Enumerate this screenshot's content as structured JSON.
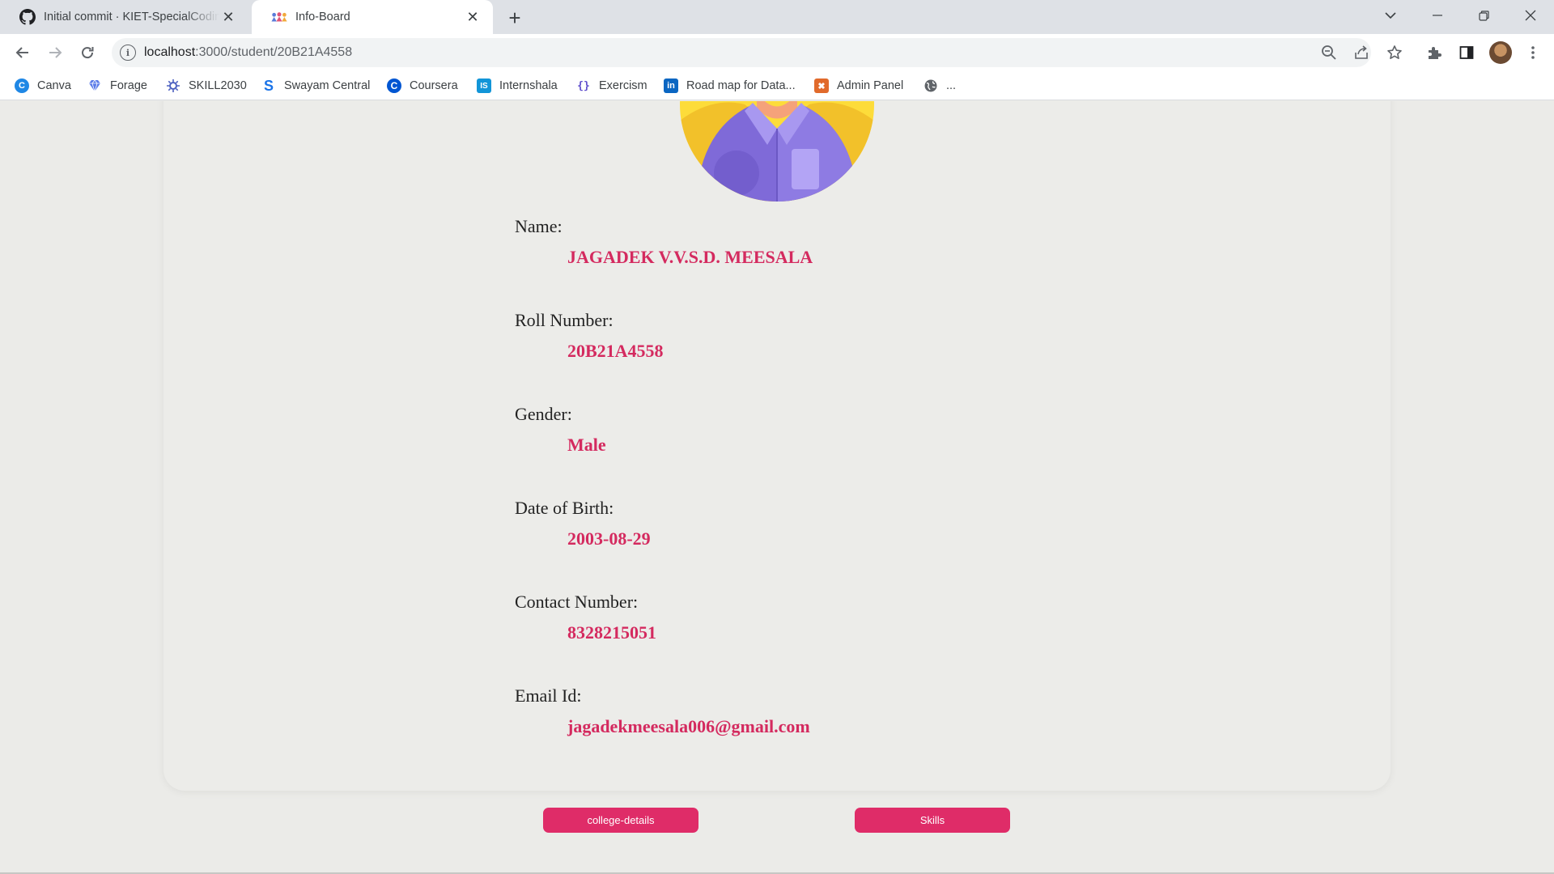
{
  "browser": {
    "tabs": [
      {
        "title": "Initial commit · KIET-SpecialCoding",
        "close": "✕"
      },
      {
        "title": "Info-Board",
        "close": "✕"
      }
    ],
    "new_tab": "+",
    "url": {
      "host": "localhost",
      "path": ":3000/student/20B21A4558"
    },
    "bookmarks": [
      {
        "label": "Canva",
        "icon": "canva-icon",
        "color": "#1f87e5"
      },
      {
        "label": "Forage",
        "icon": "forage-icon",
        "color": "#5b7be8"
      },
      {
        "label": "SKILL2030",
        "icon": "skill2030-icon",
        "color": "#4b5fc0"
      },
      {
        "label": "Swayam Central",
        "icon": "swayam-icon",
        "color": "#1a73e8"
      },
      {
        "label": "Coursera",
        "icon": "coursera-icon",
        "color": "#0056d2"
      },
      {
        "label": "Internshala",
        "icon": "internshala-icon",
        "color": "#1295d8"
      },
      {
        "label": "Exercism",
        "icon": "exercism-icon",
        "color": "#604fcd"
      },
      {
        "label": "Road map for Data...",
        "icon": "linkedin-icon",
        "color": "#0a66c2"
      },
      {
        "label": "Admin Panel",
        "icon": "xampp-icon",
        "color": "#e16a2b"
      },
      {
        "label": "...",
        "icon": "globe-icon",
        "color": "#5f6368"
      }
    ]
  },
  "student": {
    "fields": [
      {
        "label": "Name:",
        "value": "JAGADEK V.V.S.D. MEESALA"
      },
      {
        "label": "Roll Number:",
        "value": "20B21A4558"
      },
      {
        "label": "Gender:",
        "value": "Male"
      },
      {
        "label": "Date of Birth:",
        "value": "2003-08-29"
      },
      {
        "label": "Contact Number:",
        "value": "8328215051"
      },
      {
        "label": "Email Id:",
        "value": "jagadekmeesala006@gmail.com"
      }
    ]
  },
  "actions": {
    "college_details": "college-details",
    "skills": "Skills"
  },
  "colors": {
    "accent": "#df2c68",
    "value_text": "#d42a5f",
    "page_bg": "#ebebe8"
  }
}
